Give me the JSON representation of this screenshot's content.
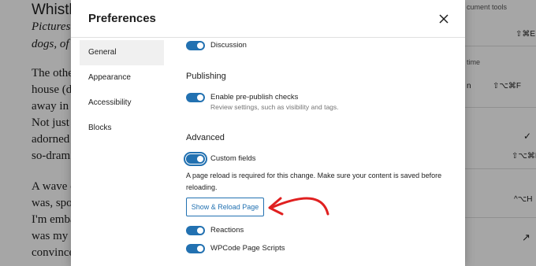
{
  "background": {
    "title": "Whistli",
    "lines": [
      {
        "text": "Pictures",
        "italic": true
      },
      {
        "text": "dogs, of",
        "italic": true
      },
      {
        "text": "The othe",
        "italic": false
      },
      {
        "text": "house (d",
        "italic": false
      },
      {
        "text": "away in a",
        "italic": false
      },
      {
        "text": "Not just a",
        "italic": false
      },
      {
        "text": "adorned",
        "italic": false
      },
      {
        "text": "so-dram",
        "italic": false
      },
      {
        "text": "A wave c",
        "italic": false
      },
      {
        "text": "was, spo",
        "italic": false
      },
      {
        "text": "I'm emba",
        "italic": false
      },
      {
        "text": "was my b",
        "italic": false
      },
      {
        "text": "convince",
        "italic": false
      }
    ],
    "right_panel": {
      "label_top": "cument tools",
      "shortcut_1": "⇧⌘E",
      "label_mid": "time",
      "label_n": "n",
      "shortcut_2": "⇧⌥⌘F",
      "check_icon": "✓",
      "shortcut_3": "⇧⌥⌘M",
      "shortcut_4": "^⌥H",
      "external_icon": "↗"
    }
  },
  "modal": {
    "title": "Preferences",
    "close_icon": "close-icon",
    "nav": [
      {
        "label": "General",
        "active": true
      },
      {
        "label": "Appearance",
        "active": false
      },
      {
        "label": "Accessibility",
        "active": false
      },
      {
        "label": "Blocks",
        "active": false
      }
    ],
    "options": {
      "discussion": {
        "label": "Discussion",
        "enabled": true
      },
      "publishing_heading": "Publishing",
      "prepublish": {
        "label": "Enable pre-publish checks",
        "help": "Review settings, such as visibility and tags.",
        "enabled": true
      },
      "advanced_heading": "Advanced",
      "custom_fields": {
        "label": "Custom fields",
        "enabled": true
      },
      "notice": "A page reload is required for this change. Make sure your content is saved before reloading.",
      "reload_button": "Show & Reload Page",
      "reactions": {
        "label": "Reactions",
        "enabled": true
      },
      "wpcode": {
        "label": "WPCode Page Scripts",
        "enabled": true
      }
    },
    "accent_color": "#2271b1",
    "annotation_color": "#e02020"
  }
}
